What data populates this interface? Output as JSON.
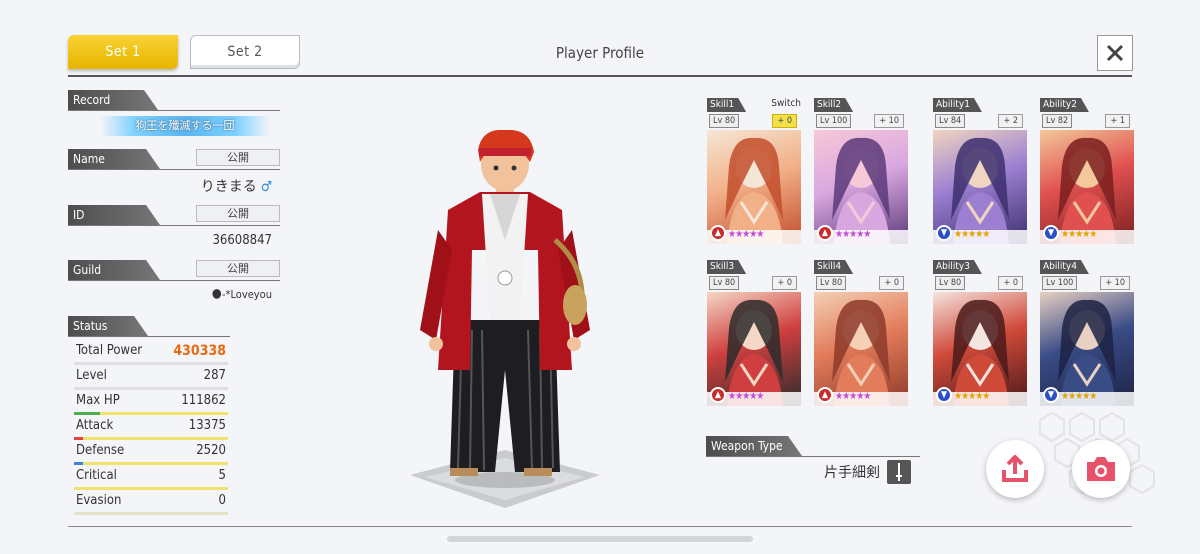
{
  "tabs": [
    {
      "label": "Set 1",
      "active": true
    },
    {
      "label": "Set 2",
      "active": false
    }
  ],
  "header": {
    "title": "Player Profile"
  },
  "record": {
    "header": "Record",
    "banner": "狗王を殲滅する一団"
  },
  "name": {
    "header": "Name",
    "visibility": "公開",
    "value": "りきまる",
    "gender": "♂"
  },
  "id": {
    "header": "ID",
    "visibility": "公開",
    "value": "36608847"
  },
  "guild": {
    "header": "Guild",
    "visibility": "公開",
    "value": "🌑-*Loveyou"
  },
  "status": {
    "header": "Status",
    "rows": [
      {
        "label": "Total Power",
        "value": "430338",
        "bar_color": "",
        "bar_fill": 0
      },
      {
        "label": "Level",
        "value": "287",
        "bar_color": "",
        "bar_fill": 0
      },
      {
        "label": "Max HP",
        "value": "111862",
        "bar_color": "#4caf50",
        "bar_fill": 0.17
      },
      {
        "label": "Attack",
        "value": "13375",
        "bar_color": "#e84040",
        "bar_fill": 0.06
      },
      {
        "label": "Defense",
        "value": "2520",
        "bar_color": "#3f7fe0",
        "bar_fill": 0.06
      },
      {
        "label": "Critical",
        "value": "5",
        "bar_color": "#e7d22d",
        "bar_fill": 0
      },
      {
        "label": "Evasion",
        "value": "0",
        "bar_color": "#9a9aa4",
        "bar_fill": 0
      }
    ]
  },
  "skills": [
    {
      "tag": "Skill1",
      "extra": "Switch",
      "level": "Lv 80",
      "plus": "+ 0",
      "gold": true,
      "elem": "fire",
      "colors": [
        "#f2b089",
        "#c24d2b",
        "#f5e7d6"
      ]
    },
    {
      "tag": "Skill2",
      "extra": "",
      "level": "Lv 100",
      "plus": "+ 10",
      "gold": false,
      "elem": "fire",
      "colors": [
        "#d9a7e0",
        "#5b3a7a",
        "#f7c8d7"
      ]
    },
    {
      "tag": "Ability1",
      "extra": "",
      "level": "Lv 84",
      "plus": "+ 2",
      "gold": false,
      "elem": "water",
      "colors": [
        "#9c7fd1",
        "#3c2f6e",
        "#f0d5c0"
      ]
    },
    {
      "tag": "Ability2",
      "extra": "",
      "level": "Lv 82",
      "plus": "+ 1",
      "gold": false,
      "elem": "water",
      "colors": [
        "#e05050",
        "#7a1f1f",
        "#f3c89a"
      ]
    },
    {
      "tag": "Skill3",
      "extra": "",
      "level": "Lv 80",
      "plus": "+ 0",
      "gold": false,
      "elem": "fire",
      "colors": [
        "#cf3f3f",
        "#2c2c2c",
        "#f5d7c5"
      ]
    },
    {
      "tag": "Skill4",
      "extra": "",
      "level": "Lv 80",
      "plus": "+ 0",
      "gold": false,
      "elem": "fire",
      "colors": [
        "#e27c5a",
        "#8d3a2a",
        "#f4d0b5"
      ]
    },
    {
      "tag": "Ability3",
      "extra": "",
      "level": "Lv 80",
      "plus": "+ 0",
      "gold": false,
      "elem": "water",
      "colors": [
        "#d04a3a",
        "#4a1a1a",
        "#f5e5e0"
      ]
    },
    {
      "tag": "Ability4",
      "extra": "",
      "level": "Lv 100",
      "plus": "+ 10",
      "gold": false,
      "elem": "water",
      "colors": [
        "#3a4c86",
        "#1c2243",
        "#e8d0c3"
      ]
    }
  ],
  "weapon": {
    "header": "Weapon Type",
    "value": "片手細剣"
  },
  "icons": {
    "close": "close-icon",
    "share": "share-icon",
    "camera": "camera-icon"
  }
}
